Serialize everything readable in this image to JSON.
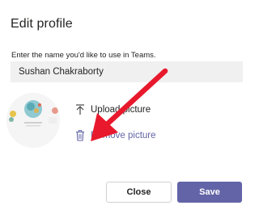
{
  "dialog": {
    "title": "Edit profile",
    "name_label": "Enter the name you'd like to use in Teams.",
    "name_value": "Sushan Chakraborty",
    "upload_label": "Upload picture",
    "remove_label": "Remove picture",
    "close_label": "Close",
    "save_label": "Save"
  },
  "icons": {
    "upload": "upload-arrow-icon",
    "remove": "trash-icon"
  },
  "colors": {
    "accent": "#6264a7",
    "annotation_arrow": "#e8192c"
  }
}
